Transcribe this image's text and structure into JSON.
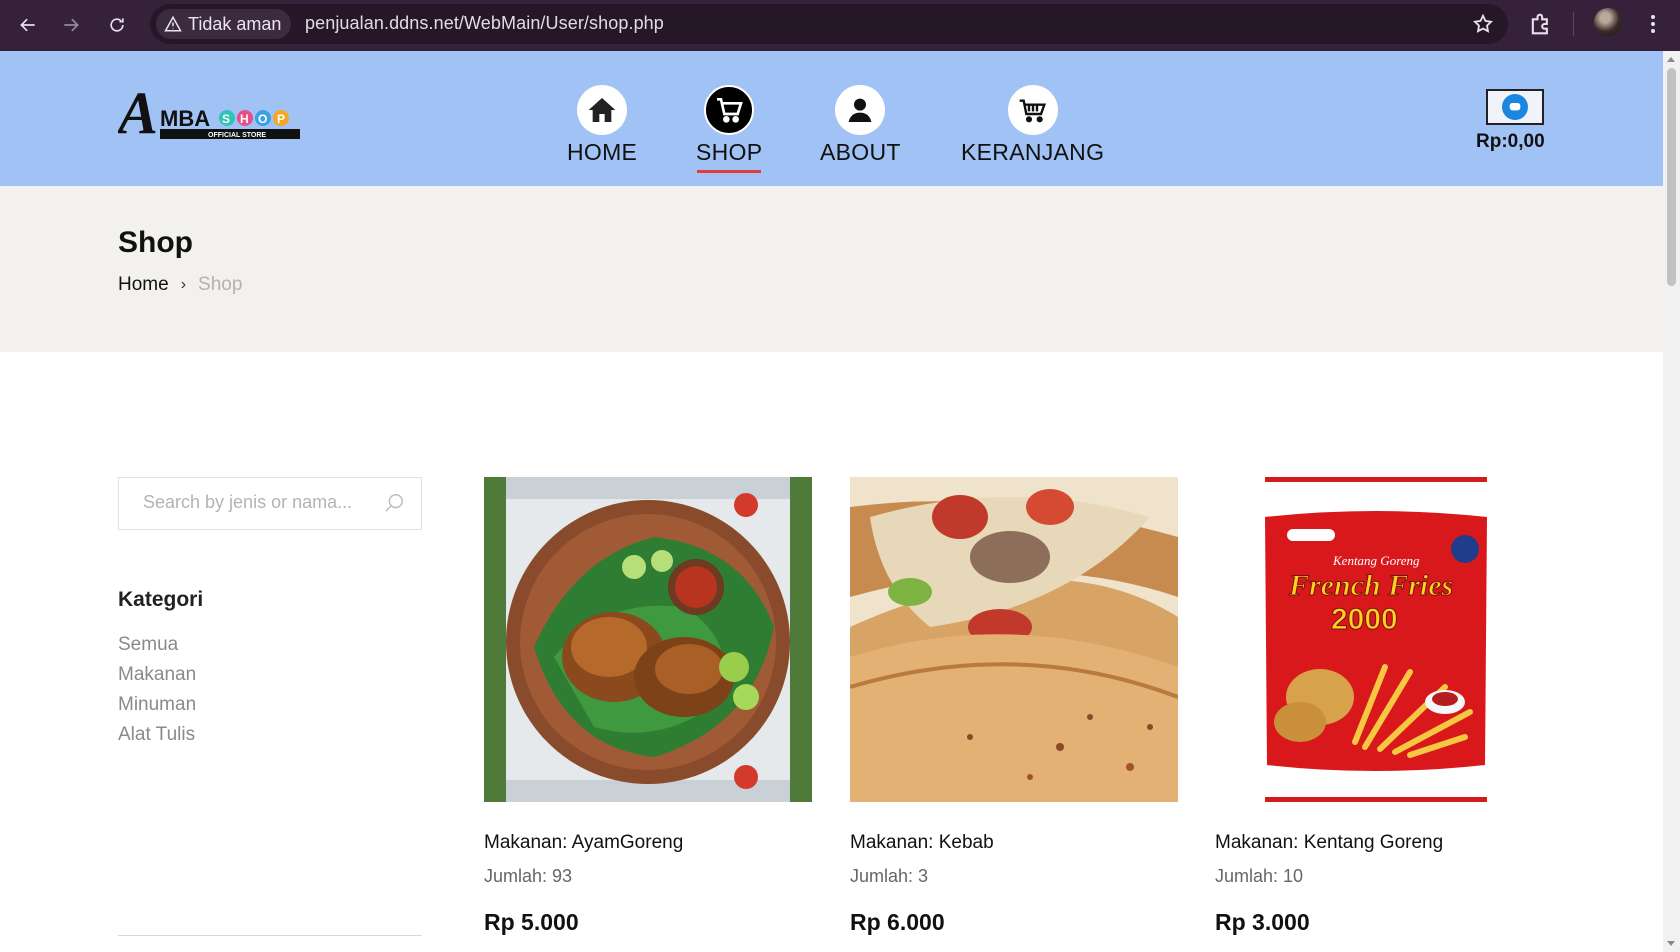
{
  "browser": {
    "security_label": "Tidak aman",
    "url": "penjualan.ddns.net/WebMain/User/shop.php"
  },
  "header": {
    "logo_text": "MBA",
    "logo_letter": "A",
    "logo_shop": "SHOP",
    "logo_tagline": "OFFICIAL STORE",
    "nav": [
      {
        "label": "HOME",
        "icon": "home-icon"
      },
      {
        "label": "SHOP",
        "icon": "cart-icon",
        "active": true
      },
      {
        "label": "ABOUT",
        "icon": "user-icon"
      },
      {
        "label": "KERANJANG",
        "icon": "basket-icon"
      }
    ],
    "cart_total": "Rp:0,00"
  },
  "page": {
    "title": "Shop",
    "breadcrumb": {
      "home": "Home",
      "current": "Shop"
    }
  },
  "sidebar": {
    "search_placeholder": "Search by jenis or nama...",
    "category_title": "Kategori",
    "categories": [
      "Semua",
      "Makanan",
      "Minuman",
      "Alat Tulis"
    ]
  },
  "products": [
    {
      "name": "Makanan: AyamGoreng",
      "qty": "Jumlah: 93",
      "price": "Rp 5.000"
    },
    {
      "name": "Makanan: Kebab",
      "qty": "Jumlah: 3",
      "price": "Rp 6.000"
    },
    {
      "name": "Makanan: Kentang Goreng",
      "qty": "Jumlah: 10",
      "price": "Rp 3.000"
    }
  ],
  "product_images": {
    "fries_pack_title": "French Fries",
    "fries_pack_subtitle": "Kentang Goreng",
    "fries_pack_number": "2000"
  },
  "colors": {
    "header_bg": "#a1c2f5",
    "band_bg": "#f2f1ee",
    "active_underline": "#e33a3a",
    "chrome_bg": "#35213a"
  }
}
